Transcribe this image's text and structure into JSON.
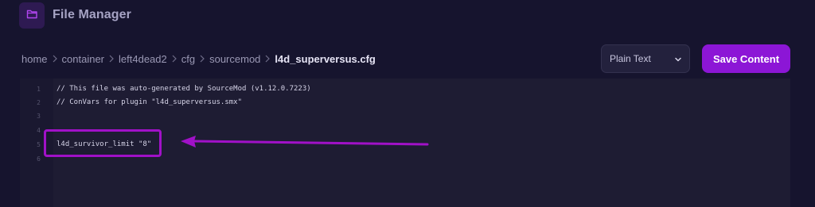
{
  "app": {
    "title": "File Manager",
    "icon": "folder-icon"
  },
  "breadcrumb": [
    "home",
    "container",
    "left4dead2",
    "cfg",
    "sourcemod",
    "l4d_superversus.cfg"
  ],
  "toolbar": {
    "mode_selected": "Plain Text",
    "save_label": "Save Content"
  },
  "editor": {
    "line_numbers": [
      "1",
      "2",
      "3",
      "4",
      "5",
      "6"
    ],
    "lines": [
      "// This file was auto-generated by SourceMod (v1.12.0.7223)",
      "// ConVars for plugin \"l4d_superversus.smx\"",
      "",
      "",
      "l4d_survivor_limit \"8\"",
      ""
    ]
  },
  "annotation": {
    "color": "#a111c8",
    "highlighted_line": 5
  },
  "colors": {
    "accent": "#8c16d6",
    "background": "#16142e",
    "editor_bg": "#1e1c33"
  }
}
